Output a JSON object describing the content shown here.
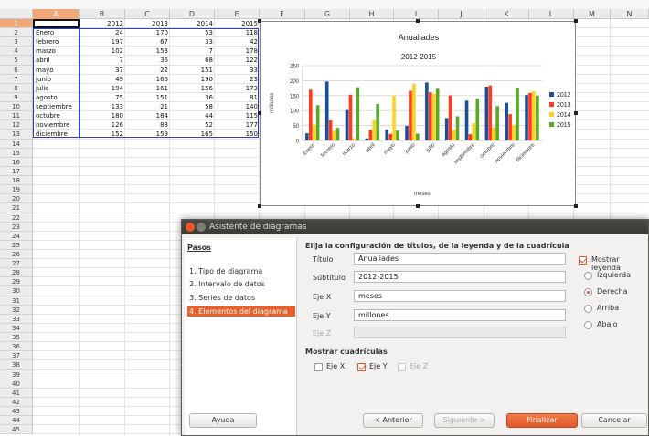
{
  "columns": [
    "A",
    "B",
    "C",
    "D",
    "E",
    "F",
    "G",
    "H",
    "I",
    "J",
    "K",
    "L",
    "M",
    "N"
  ],
  "selected_column": "A",
  "selected_row": "1",
  "rows": [
    "1",
    "2",
    "3",
    "4",
    "5",
    "6",
    "7",
    "8",
    "9",
    "10",
    "11",
    "12",
    "13",
    "14",
    "15",
    "16",
    "17",
    "18",
    "19",
    "20",
    "21",
    "22",
    "23",
    "24",
    "25",
    "26",
    "27",
    "28",
    "29",
    "30",
    "31",
    "32",
    "33",
    "34",
    "35",
    "36",
    "37",
    "38",
    "39",
    "40",
    "41",
    "42",
    "43",
    "44",
    "45"
  ],
  "table": {
    "header": [
      "",
      "2012",
      "2013",
      "2014",
      "2015"
    ],
    "rows": [
      [
        "Enero",
        "24",
        "170",
        "53",
        "118"
      ],
      [
        "febrero",
        "197",
        "67",
        "33",
        "42"
      ],
      [
        "marzo",
        "102",
        "153",
        "7",
        "178"
      ],
      [
        "abril",
        "7",
        "36",
        "68",
        "122"
      ],
      [
        "mayo",
        "37",
        "22",
        "151",
        "33"
      ],
      [
        "junio",
        "49",
        "166",
        "190",
        "23"
      ],
      [
        "julio",
        "194",
        "161",
        "156",
        "173"
      ],
      [
        "agosto",
        "75",
        "151",
        "36",
        "81"
      ],
      [
        "septiembre",
        "133",
        "21",
        "58",
        "140"
      ],
      [
        "octubre",
        "180",
        "184",
        "44",
        "115"
      ],
      [
        "noviembre",
        "126",
        "88",
        "52",
        "177"
      ],
      [
        "diciembre",
        "152",
        "159",
        "165",
        "150"
      ]
    ]
  },
  "chart_data": {
    "type": "bar",
    "title": "Anualiades",
    "subtitle": "2012-2015",
    "xlabel": "meses",
    "ylabel": "millones",
    "ylim": [
      0,
      250
    ],
    "yticks": [
      "0",
      "50",
      "100",
      "150",
      "200",
      "250"
    ],
    "grid": true,
    "legend_position": "right",
    "categories": [
      "Enero",
      "febrero",
      "marzo",
      "abril",
      "mayo",
      "junio",
      "julio",
      "agosto",
      "septiembre",
      "octubre",
      "noviembre",
      "diciembre"
    ],
    "series": [
      {
        "name": "2012",
        "color": "#1f4e99",
        "values": [
          24,
          197,
          102,
          7,
          37,
          49,
          194,
          75,
          133,
          180,
          126,
          152
        ]
      },
      {
        "name": "2013",
        "color": "#ff3b1f",
        "values": [
          170,
          67,
          153,
          36,
          22,
          166,
          161,
          151,
          21,
          184,
          88,
          159
        ]
      },
      {
        "name": "2014",
        "color": "#ffd21f",
        "values": [
          53,
          33,
          7,
          68,
          151,
          190,
          156,
          36,
          58,
          44,
          52,
          165
        ]
      },
      {
        "name": "2015",
        "color": "#58a82a",
        "values": [
          118,
          42,
          178,
          122,
          33,
          23,
          173,
          81,
          140,
          115,
          177,
          150
        ]
      }
    ]
  },
  "dialog": {
    "title": "Asistente de diagramas",
    "steps_heading": "Pasos",
    "steps": [
      "1. Tipo de diagrama",
      "2. Intervalo de datos",
      "3. Series de datos",
      "4. Elementos del diagrama"
    ],
    "section_title": "Elija la configuración de títulos, de la leyenda y de la cuadrícula",
    "fields": {
      "titulo_label": "Título",
      "titulo_value": "Anualiades",
      "subtitulo_label": "Subtítulo",
      "subtitulo_value": "2012-2015",
      "ejex_label": "Eje X",
      "ejex_value": "meses",
      "ejey_label": "Eje Y",
      "ejey_value": "millones",
      "ejez_label": "Eje Z",
      "ejez_value": ""
    },
    "legend": {
      "show_label": "Mostrar leyenda",
      "options": [
        "Izquierda",
        "Derecha",
        "Arriba",
        "Abajo"
      ],
      "selected": "Derecha"
    },
    "grids": {
      "heading": "Mostrar cuadrículas",
      "x_label": "Eje X",
      "y_label": "Eje Y",
      "z_label": "Eje Z"
    },
    "buttons": {
      "help": "Ayuda",
      "back": "< Anterior",
      "next": "Siguiente >",
      "finish": "Finalizar",
      "cancel": "Cancelar"
    }
  }
}
